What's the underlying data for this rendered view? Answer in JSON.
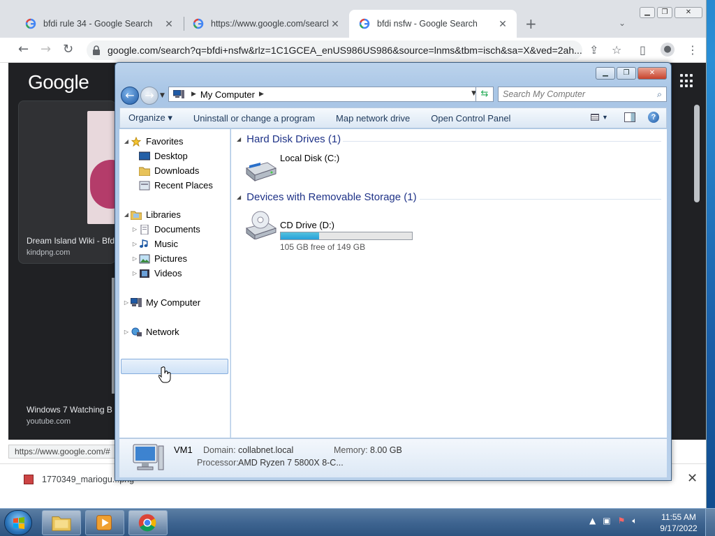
{
  "chrome": {
    "tabs": [
      {
        "title": "bfdi rule 34 - Google Search"
      },
      {
        "title": "https://www.google.com/search?"
      },
      {
        "title": "bfdi nsfw - Google Search"
      }
    ],
    "url": "google.com/search?q=bfdi+nsfw&rlz=1C1GCEA_enUS986US986&source=lnms&tbm=isch&sa=X&ved=2ah...",
    "status_url": "https://www.google.com/#",
    "download_item": "1770349_mariogu...png"
  },
  "google": {
    "logo": "Google",
    "results": [
      {
        "caption": "Dream Island Wiki - Bfdi",
        "source": "kindpng.com"
      },
      {
        "caption": "Windows 7 Watching B",
        "source": "youtube.com"
      }
    ]
  },
  "explorer": {
    "breadcrumb": "My Computer",
    "search_placeholder": "Search My Computer",
    "commands": [
      "Organize ▾",
      "Uninstall or change a program",
      "Map network drive",
      "Open Control Panel"
    ],
    "nav": {
      "favorites": "Favorites",
      "desktop": "Desktop",
      "downloads": "Downloads",
      "recent": "Recent Places",
      "libraries": "Libraries",
      "documents": "Documents",
      "music": "Music",
      "pictures": "Pictures",
      "videos": "Videos",
      "computer": "My Computer",
      "network": "Network"
    },
    "groups": {
      "hdd": "Hard Disk Drives (1)",
      "removable": "Devices with Removable Storage (1)"
    },
    "local_disk": {
      "name": "Local Disk (C:)",
      "free_text": "105 GB free of 149 GB",
      "used_fraction": 0.295
    },
    "cd_drive": {
      "name": "CD Drive (D:)"
    },
    "details": {
      "computer_name": "VM1",
      "domain_label": "Domain:",
      "domain": "collabnet.local",
      "memory_label": "Memory:",
      "memory": "8.00 GB",
      "processor_label": "Processor:",
      "processor": "AMD Ryzen 7 5800X 8-C..."
    }
  },
  "taskbar": {
    "time": "11:55 AM",
    "date": "9/17/2022"
  }
}
